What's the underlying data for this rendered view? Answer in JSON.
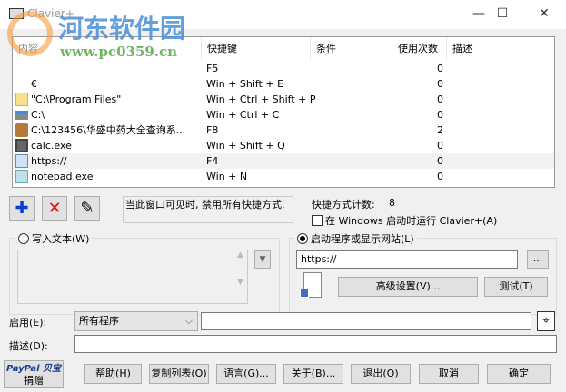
{
  "window": {
    "title": "Clavier+",
    "watermark": "河东软件园",
    "watermark_url": "www.pc0359.cn",
    "minimize": "—",
    "maximize": "☐",
    "close": "✕"
  },
  "list": {
    "columns": [
      "内容",
      "快捷键",
      "条件",
      "使用次数",
      "描述"
    ],
    "rows": [
      {
        "content": "",
        "shortcut": "F5",
        "count": "0",
        "icon": "none"
      },
      {
        "content": "€",
        "shortcut": "Win + Shift + E",
        "count": "0",
        "icon": "none"
      },
      {
        "content": "\"C:\\Program Files\"",
        "shortcut": "Win + Ctrl + Shift + P",
        "count": "0",
        "icon": "folder-icon"
      },
      {
        "content": "C:\\",
        "shortcut": "Win + Ctrl + C",
        "count": "0",
        "icon": "drive-icon"
      },
      {
        "content": "C:\\123456\\华盛中药大全查询系...",
        "shortcut": "F8",
        "count": "2",
        "icon": "app-icon"
      },
      {
        "content": "calc.exe",
        "shortcut": "Win + Shift + Q",
        "count": "0",
        "icon": "calculator-icon"
      },
      {
        "content": "https://",
        "shortcut": "F4",
        "count": "0",
        "icon": "file-icon"
      },
      {
        "content": "notepad.exe",
        "shortcut": "Win + N",
        "count": "0",
        "icon": "notepad-icon"
      }
    ]
  },
  "toolbar": {
    "add": "✚",
    "delete": "✕",
    "edit": "✎"
  },
  "notice": "当此窗口可见时, 禁用所有快捷方式.",
  "count_label": "快捷方式计数:",
  "count_value": "8",
  "startup_label": "在 Windows 启动时运行 Clavier+(A)",
  "write_text": {
    "label": "写入文本(W)"
  },
  "launch": {
    "label": "启动程序或显示网站(L)",
    "value": "https://",
    "browse": "...",
    "advanced": "高级设置(V)...",
    "test": "测试(T)"
  },
  "enable": {
    "label": "启用(E):",
    "selected": "所有程序",
    "value": ""
  },
  "description": {
    "label": "描述(D):",
    "value": ""
  },
  "paypal": {
    "brand": "PayPal 贝宝",
    "label": "捐赠"
  },
  "buttons": [
    "帮助(H)",
    "复制列表(O)",
    "语言(G)...",
    "关于(B)...",
    "退出(Q)",
    "取消",
    "确定"
  ],
  "colors": {
    "accent": "#0a3cd8",
    "delete": "#e01010",
    "selected_row": "#f2f2f2"
  }
}
